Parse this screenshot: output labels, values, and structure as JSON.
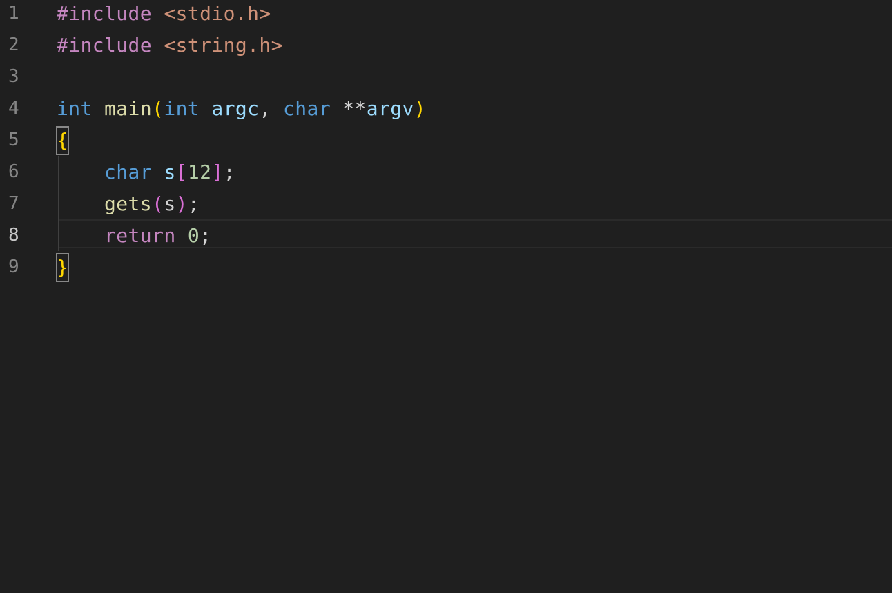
{
  "editor": {
    "line_numbers": [
      "1",
      "2",
      "3",
      "4",
      "5",
      "6",
      "7",
      "8",
      "9"
    ],
    "active_line": "8",
    "lines": {
      "l1": {
        "directive": "#include",
        "header": "<stdio.h>"
      },
      "l2": {
        "directive": "#include",
        "header": "<string.h>"
      },
      "l4": {
        "ret_type": "int",
        "func": "main",
        "open_paren": "(",
        "p1_type": "int",
        "p1_name": "argc",
        "comma": ",",
        "p2_type": "char",
        "stars": "**",
        "p2_name": "argv",
        "close_paren": ")"
      },
      "l5": {
        "brace": "{"
      },
      "l6": {
        "type": "char",
        "name": "s",
        "lbr": "[",
        "size": "12",
        "rbr": "]",
        "semi": ";"
      },
      "l7": {
        "func": "gets",
        "lp": "(",
        "arg": "s",
        "rp": ")",
        "semi": ";"
      },
      "l8": {
        "kw": "return",
        "value": "0",
        "semi": ";"
      },
      "l9": {
        "brace": "}"
      }
    }
  },
  "colors": {
    "background": "#1f1f1f",
    "preprocessor": "#c586c0",
    "string": "#ce9178",
    "type": "#569cd6",
    "function": "#dcdcaa",
    "variable": "#9cdcfe",
    "bracket_level1": "#ffd700",
    "bracket_level2": "#da70d6",
    "number": "#b5cea8"
  }
}
